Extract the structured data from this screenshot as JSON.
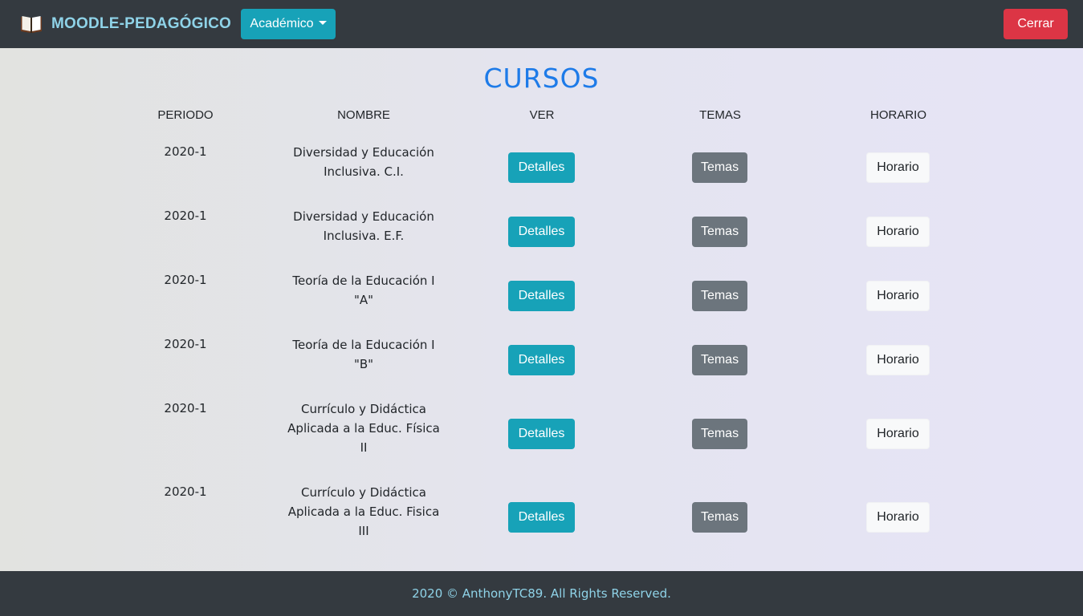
{
  "navbar": {
    "brand": "MOODLE-PEDAGÓGICO",
    "brand_icon": "open-book-icon",
    "academico_label": "Académico",
    "cerrar_label": "Cerrar"
  },
  "title": "CURSOS",
  "table": {
    "headers": [
      "PERIODO",
      "NOMBRE",
      "VER",
      "TEMAS",
      "HORARIO"
    ],
    "rows": [
      {
        "periodo": "2020-1",
        "nombre": [
          "Diversidad y Educación",
          "Inclusiva. C.I."
        ],
        "ver": "Detalles",
        "temas": "Temas",
        "horario": "Horario"
      },
      {
        "periodo": "2020-1",
        "nombre": [
          "Diversidad y Educación",
          "Inclusiva. E.F."
        ],
        "ver": "Detalles",
        "temas": "Temas",
        "horario": "Horario"
      },
      {
        "periodo": "2020-1",
        "nombre": [
          "Teoría de la Educación I",
          "\"A\""
        ],
        "ver": "Detalles",
        "temas": "Temas",
        "horario": "Horario"
      },
      {
        "periodo": "2020-1",
        "nombre": [
          "Teoría de la Educación I",
          "\"B\""
        ],
        "ver": "Detalles",
        "temas": "Temas",
        "horario": "Horario"
      },
      {
        "periodo": "2020-1",
        "nombre": [
          "Currículo y Didáctica",
          "Aplicada a la Educ. Física",
          "II"
        ],
        "ver": "Detalles",
        "temas": "Temas",
        "horario": "Horario"
      },
      {
        "periodo": "2020-1",
        "nombre": [
          "Currículo y Didáctica",
          "Aplicada a la Educ. Fisica",
          "III"
        ],
        "ver": "Detalles",
        "temas": "Temas",
        "horario": "Horario"
      }
    ]
  },
  "footer": "2020 © AnthonyTC89. All Rights Reserved.",
  "colors": {
    "navbar_bg": "#343a40",
    "info": "#17a2b8",
    "danger": "#dc3545",
    "secondary": "#6c757d",
    "light": "#f8f9fa",
    "title": "#1e7be8",
    "brand": "#8fd3e8"
  }
}
